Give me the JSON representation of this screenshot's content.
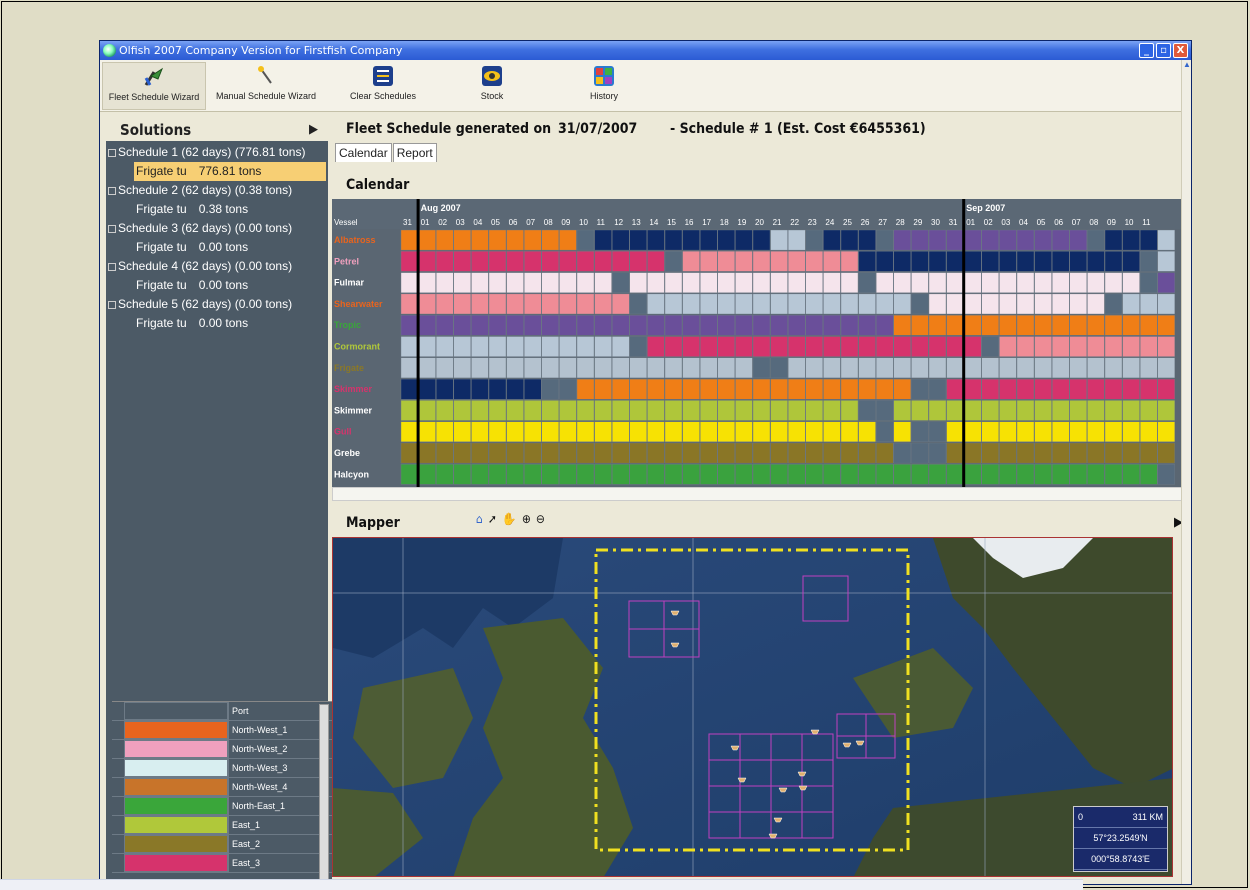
{
  "window": {
    "title": "Olfish 2007 Company Version for Firstfish Company",
    "buttons": [
      "_",
      "▫",
      "X"
    ]
  },
  "toolbar": {
    "buttons": [
      {
        "label": "Fleet Schedule Wizard",
        "icon": "wand-fleet-icon"
      },
      {
        "label": "Manual Schedule Wizard",
        "icon": "magic-wand-icon"
      },
      {
        "label": "Clear Schedules",
        "icon": "clear-schedules-icon"
      },
      {
        "label": "Stock",
        "icon": "stock-eye-icon"
      },
      {
        "label": "History",
        "icon": "history-grid-icon"
      }
    ]
  },
  "solutions": {
    "title": "Solutions",
    "schedules": [
      {
        "label": "Schedule 1 (62 days) (776.81 tons)",
        "sub": "Frigate tu",
        "tons": "776.81 tons",
        "selected": true
      },
      {
        "label": "Schedule 2 (62 days) (0.38 tons)",
        "sub": "Frigate tu",
        "tons": "0.38 tons"
      },
      {
        "label": "Schedule 3 (62 days) (0.00 tons)",
        "sub": "Frigate tu",
        "tons": "0.00 tons"
      },
      {
        "label": "Schedule 4 (62 days) (0.00 tons)",
        "sub": "Frigate tu",
        "tons": "0.00 tons"
      },
      {
        "label": "Schedule 5 (62 days) (0.00 tons)",
        "sub": "Frigate tu",
        "tons": "0.00 tons"
      }
    ]
  },
  "legend": [
    {
      "name": "Port",
      "color": "#4c5a66"
    },
    {
      "name": "North-West_1",
      "color": "#e8641e"
    },
    {
      "name": "North-West_2",
      "color": "#f0a0be"
    },
    {
      "name": "North-West_3",
      "color": "#d8eef0"
    },
    {
      "name": "North-West_4",
      "color": "#c8742a"
    },
    {
      "name": "North-East_1",
      "color": "#3aa63a"
    },
    {
      "name": "East_1",
      "color": "#b0c83a"
    },
    {
      "name": "East_2",
      "color": "#8a7828"
    },
    {
      "name": "East_3",
      "color": "#d6336c"
    }
  ],
  "schedule_header": {
    "prefix": "Fleet Schedule generated on",
    "date": "31/07/2007",
    "suffix": "- Schedule # 1 (Est. Cost €6455361)"
  },
  "tabs": [
    "Calendar",
    "Report"
  ],
  "calendar": {
    "title": "Calendar",
    "vessel_header": "Vessel",
    "months": [
      {
        "label": "Aug 2007",
        "start_index": 1
      },
      {
        "label": "Sep 2007",
        "start_index": 32
      }
    ],
    "days": [
      "31",
      "01",
      "02",
      "03",
      "04",
      "05",
      "06",
      "07",
      "08",
      "09",
      "10",
      "11",
      "12",
      "13",
      "14",
      "15",
      "16",
      "17",
      "18",
      "19",
      "20",
      "21",
      "22",
      "23",
      "24",
      "25",
      "26",
      "27",
      "28",
      "29",
      "30",
      "31",
      "01",
      "02",
      "03",
      "04",
      "05",
      "06",
      "07",
      "08",
      "09",
      "10",
      "11"
    ],
    "vessels": [
      {
        "name": "Albatross",
        "color": "#e8641e",
        "cells": "OOOOOOOOOOPNNNNNNNNNNLLPNNNPVVVVVVVVVVVPNNNLL"
      },
      {
        "name": "Petrel",
        "color": "#f0a0be",
        "cells": "RRRRRRRRRRRRRRRPSSSSSSSSSSNNNNNNNNNNNNNNNNPLLLL"
      },
      {
        "name": "Fulmar",
        "color": "#ffffff",
        "cells": "WWWWWWWWWWWWPWWWWWWWWWWWWWPWWWWWWWWWWWWWWWPVVVV"
      },
      {
        "name": "Shearwater",
        "color": "#e8641e",
        "cells": "SSSSSSSSSSSSSPLLLLLLLLLLLLLLLPWWWWWWWWWWPLLLLLLL"
      },
      {
        "name": "Tropic",
        "color": "#3aa63a",
        "cells": "VVVVVVVVVVVVVVVVVVVVVVVVVVVVOOOOOOOOOOOOOOOOOPOO"
      },
      {
        "name": "Cormorant",
        "color": "#b0c83a",
        "cells": "LLLLLLLLLLLLLPRRRRRRRRRRRRRRRRRRRPSSSSSSSSSSSSSS"
      },
      {
        "name": "Frigate",
        "color": "#8a7828",
        "cells": "GGGGGGGGGGGGGGGGGGGGPPGGGGGGGGGGGGGGGGGGGGGGGGPP"
      },
      {
        "name": "Skimmer",
        "color": "#d6336c",
        "cells": "NNNNNNNNPPOOOOOOOOOOOOOOOOOOOPPRRRRRRRRRRRRRRRRR"
      },
      {
        "name": "Skimmer",
        "color": "#ffffff",
        "cells": "YYYYYYYYYYYYYYYYYYYYYYYYYYPPYYYYYYYYYYYYYYYYYYYY"
      },
      {
        "name": "Gull",
        "color": "#d6336c",
        "cells": "KKKKKKKKKKKKKKKKKKKKKKKKKKKPKPPKKKKKKKKKKKKKKKKK"
      },
      {
        "name": "Grebe",
        "color": "#ffffff",
        "cells": "BBBBBBBBBBBBBBBBBBBBBBBBBBBBPPPBBBBBBBBBBBBBBBBB"
      },
      {
        "name": "Halcyon",
        "color": "#ffffff",
        "cells": "EEEEEEEEEEEEEEEEEEEEEEEEEEEEEEEEEEEEEEEEEEEPPPPP"
      }
    ]
  },
  "mapper": {
    "title": "Mapper",
    "tools": [
      "home-icon",
      "arrow-icon",
      "pan-hand-icon",
      "zoom-in-icon",
      "zoom-out-icon"
    ],
    "scale_label": "0",
    "scale_distance": "311 KM",
    "latitude": "57°23.2549'N",
    "longitude": "000°58.8743'E"
  }
}
